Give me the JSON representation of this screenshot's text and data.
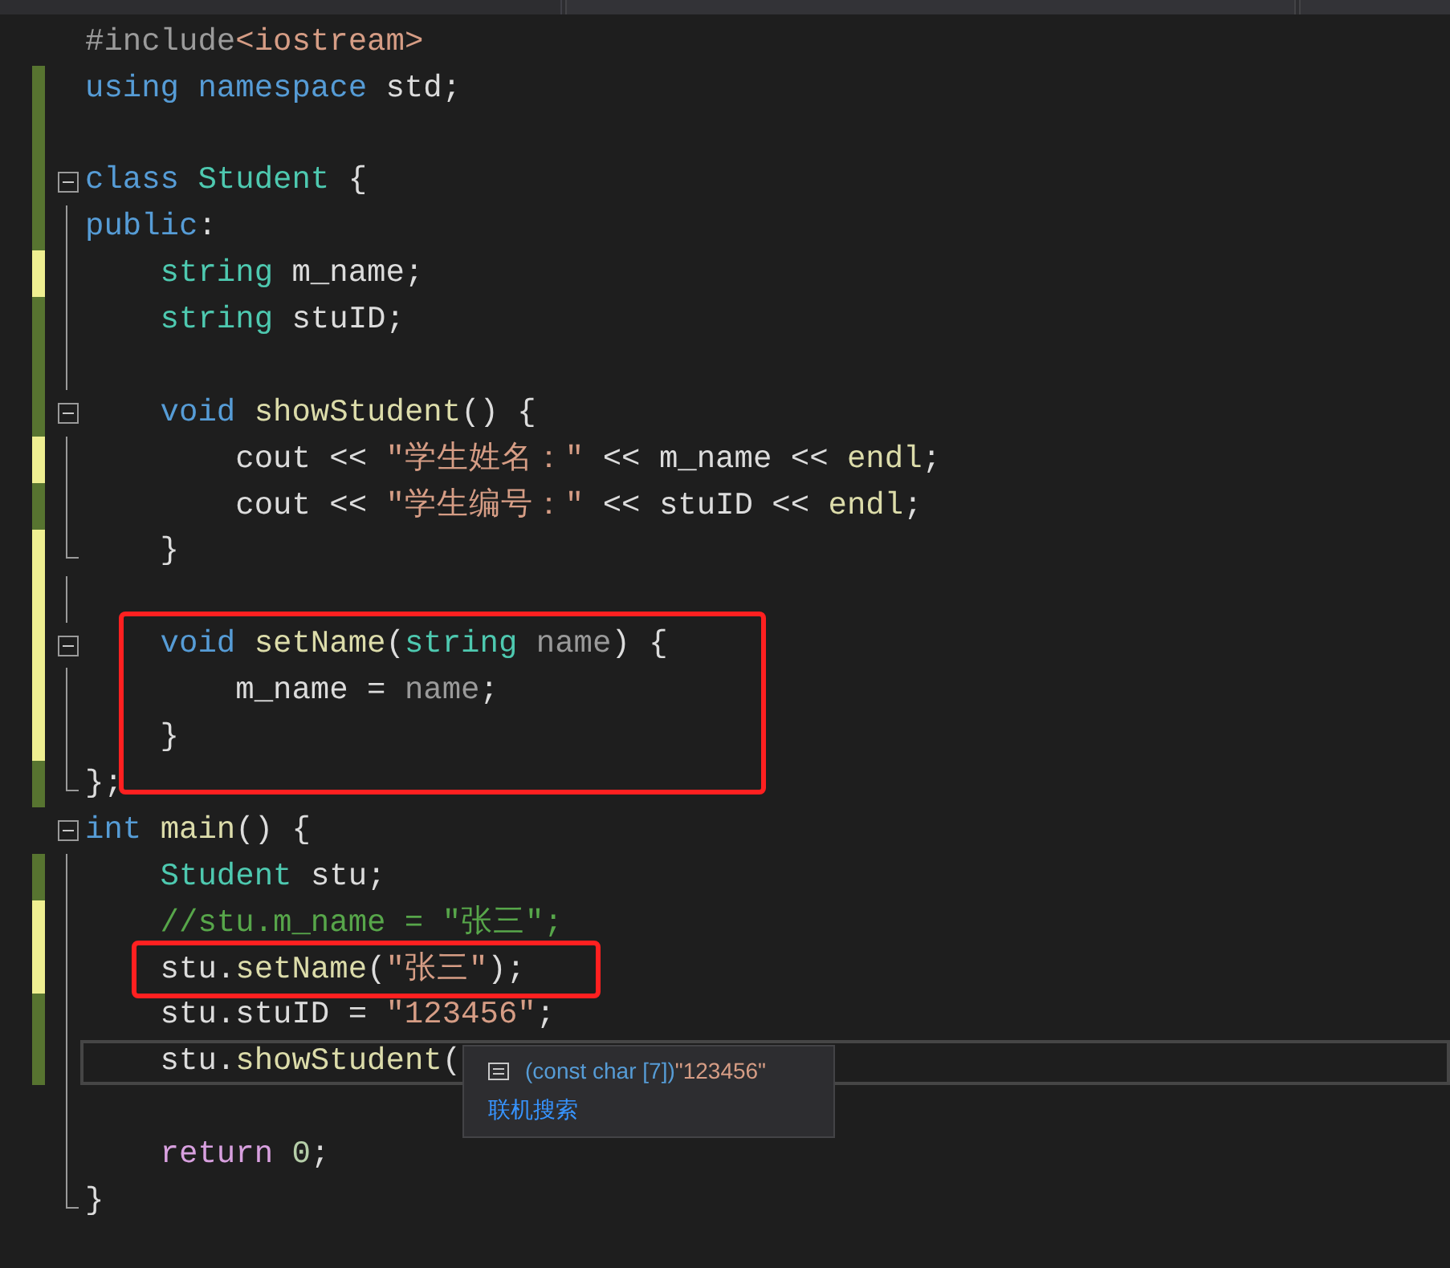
{
  "lines": [
    {
      "changed": false,
      "collapsible": false,
      "in_block": false,
      "block_end": false,
      "current": false,
      "tokens": [
        {
          "kind": "pre",
          "s": "#include"
        },
        {
          "kind": "str",
          "s": "<iostream>"
        }
      ]
    },
    {
      "changed": true,
      "saved": true,
      "collapsible": false,
      "in_block": false,
      "block_end": false,
      "current": false,
      "tokens": [
        {
          "kind": "kw",
          "s": "using namespace "
        },
        {
          "kind": "plain",
          "s": "std;"
        }
      ]
    },
    {
      "changed": true,
      "saved": true,
      "collapsible": false,
      "in_block": false,
      "block_end": false,
      "current": false
    },
    {
      "changed": true,
      "saved": true,
      "collapsible": true,
      "current": false,
      "tokens": [
        {
          "kind": "kw",
          "s": "class "
        },
        {
          "kind": "type",
          "s": "Student "
        },
        {
          "kind": "plain",
          "s": "{"
        }
      ]
    },
    {
      "changed": true,
      "saved": true,
      "collapsible": false,
      "in_block": true,
      "block_end": false,
      "current": false,
      "tokens": [
        {
          "kind": "kw",
          "s": "public"
        },
        {
          "kind": "plain",
          "s": ":"
        }
      ]
    },
    {
      "changed": true,
      "saved": false,
      "collapsible": false,
      "in_block": true,
      "block_end": false,
      "current": false,
      "tokens": [
        {
          "kind": "type",
          "s": "    string "
        },
        {
          "kind": "plain",
          "s": "m_name;"
        }
      ]
    },
    {
      "changed": true,
      "saved": true,
      "collapsible": false,
      "in_block": true,
      "block_end": false,
      "current": false,
      "tokens": [
        {
          "kind": "type",
          "s": "    string "
        },
        {
          "kind": "plain",
          "s": "stuID;"
        }
      ]
    },
    {
      "changed": true,
      "saved": true,
      "collapsible": false,
      "in_block": true,
      "block_end": false,
      "current": false
    },
    {
      "changed": true,
      "saved": true,
      "collapsible": true,
      "current": false,
      "tokens": [
        {
          "kind": "kw",
          "s": "    void "
        },
        {
          "kind": "fn",
          "s": "showStudent"
        },
        {
          "kind": "plain",
          "s": "() {"
        }
      ]
    },
    {
      "changed": true,
      "saved": false,
      "collapsible": false,
      "in_block": true,
      "block_end": false,
      "current": false,
      "tokens": [
        {
          "kind": "plain",
          "s": "        cout << "
        },
        {
          "kind": "str",
          "s": "\"学生姓名：\""
        },
        {
          "kind": "plain",
          "s": " << m_name << "
        },
        {
          "kind": "fn",
          "s": "endl"
        },
        {
          "kind": "plain",
          "s": ";"
        }
      ]
    },
    {
      "changed": true,
      "saved": true,
      "collapsible": false,
      "in_block": true,
      "block_end": false,
      "current": false,
      "tokens": [
        {
          "kind": "plain",
          "s": "        cout << "
        },
        {
          "kind": "str",
          "s": "\"学生编号：\""
        },
        {
          "kind": "plain",
          "s": " << stuID << "
        },
        {
          "kind": "fn",
          "s": "endl"
        },
        {
          "kind": "plain",
          "s": ";"
        }
      ]
    },
    {
      "changed": true,
      "saved": false,
      "collapsible": false,
      "in_block": true,
      "block_end": true,
      "current": false,
      "tokens": [
        {
          "kind": "plain",
          "s": "    }"
        }
      ]
    },
    {
      "changed": true,
      "saved": false,
      "collapsible": false,
      "in_block": true,
      "block_end": false,
      "current": false
    },
    {
      "changed": true,
      "saved": false,
      "collapsible": true,
      "current": false,
      "tokens": [
        {
          "kind": "kw",
          "s": "    void "
        },
        {
          "kind": "fn",
          "s": "setName"
        },
        {
          "kind": "plain",
          "s": "("
        },
        {
          "kind": "type",
          "s": "string "
        },
        {
          "kind": "param",
          "s": "name"
        },
        {
          "kind": "plain",
          "s": ") {"
        }
      ]
    },
    {
      "changed": true,
      "saved": false,
      "collapsible": false,
      "in_block": true,
      "block_end": false,
      "current": false,
      "tokens": [
        {
          "kind": "plain",
          "s": "        m_name = "
        },
        {
          "kind": "param",
          "s": "name"
        },
        {
          "kind": "plain",
          "s": ";"
        }
      ]
    },
    {
      "changed": true,
      "saved": false,
      "collapsible": false,
      "in_block": true,
      "block_end": false,
      "current": false,
      "tokens": [
        {
          "kind": "plain",
          "s": "    }"
        }
      ]
    },
    {
      "changed": true,
      "saved": true,
      "collapsible": false,
      "in_block": true,
      "block_end": true,
      "current": false,
      "tokens": [
        {
          "kind": "plain",
          "s": "};"
        }
      ]
    },
    {
      "changed": false,
      "collapsible": true,
      "current": false,
      "tokens": [
        {
          "kind": "kw",
          "s": "int "
        },
        {
          "kind": "fn",
          "s": "main"
        },
        {
          "kind": "plain",
          "s": "() {"
        }
      ]
    },
    {
      "changed": true,
      "saved": true,
      "collapsible": false,
      "in_block": true,
      "block_end": false,
      "current": false,
      "tokens": [
        {
          "kind": "type",
          "s": "    Student "
        },
        {
          "kind": "plain",
          "s": "stu;"
        }
      ]
    },
    {
      "changed": true,
      "saved": false,
      "collapsible": false,
      "in_block": true,
      "block_end": false,
      "current": false,
      "tokens": [
        {
          "kind": "comment",
          "s": "    //stu.m_name = \"张三\";"
        }
      ]
    },
    {
      "changed": true,
      "saved": false,
      "collapsible": false,
      "in_block": true,
      "block_end": false,
      "current": false,
      "tokens": [
        {
          "kind": "plain",
          "s": "    stu."
        },
        {
          "kind": "fn",
          "s": "setName"
        },
        {
          "kind": "plain",
          "s": "("
        },
        {
          "kind": "str",
          "s": "\"张三\""
        },
        {
          "kind": "plain",
          "s": ");"
        }
      ]
    },
    {
      "changed": true,
      "saved": true,
      "collapsible": false,
      "in_block": true,
      "block_end": false,
      "current": false,
      "tokens": [
        {
          "kind": "plain",
          "s": "    stu.stuID = "
        },
        {
          "kind": "str",
          "s": "\"123456\""
        },
        {
          "kind": "plain",
          "s": ";"
        }
      ]
    },
    {
      "changed": true,
      "saved": true,
      "collapsible": false,
      "in_block": true,
      "block_end": false,
      "current": true,
      "tokens": [
        {
          "kind": "plain",
          "s": "    stu."
        },
        {
          "kind": "fn",
          "s": "showStudent"
        },
        {
          "kind": "plain",
          "s": "("
        }
      ]
    },
    {
      "changed": false,
      "collapsible": false,
      "in_block": true,
      "block_end": false,
      "current": false
    },
    {
      "changed": false,
      "collapsible": false,
      "in_block": true,
      "block_end": false,
      "current": false,
      "tokens": [
        {
          "kind": "ctrl",
          "s": "    return "
        },
        {
          "kind": "num",
          "s": "0"
        },
        {
          "kind": "plain",
          "s": ";"
        }
      ]
    },
    {
      "changed": false,
      "collapsible": false,
      "in_block": true,
      "block_end": true,
      "current": false,
      "tokens": [
        {
          "kind": "plain",
          "s": "}"
        }
      ]
    }
  ],
  "tooltip": {
    "type": "(const char [7])",
    "value": "\"123456\"",
    "link": "联机搜索"
  }
}
